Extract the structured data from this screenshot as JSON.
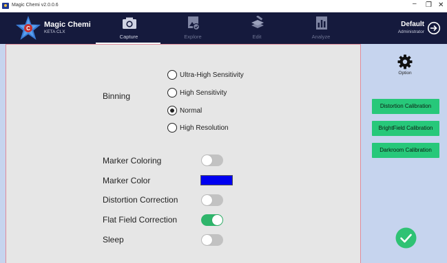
{
  "window": {
    "title": "Magic Chemi v2.0.0.6",
    "controls": [
      "–",
      "❐",
      "✕"
    ]
  },
  "brand": {
    "name": "Magic Chemi",
    "subtitle": "KETA CLX",
    "logo_letter": "C"
  },
  "nav": {
    "active": "Capture",
    "items": [
      {
        "label": "Capture",
        "icon": "camera-icon"
      },
      {
        "label": "Explore",
        "icon": "image-explore-icon"
      },
      {
        "label": "Edit",
        "icon": "edit-layers-icon"
      },
      {
        "label": "Analyze",
        "icon": "analyze-icon"
      }
    ]
  },
  "user": {
    "name": "Default",
    "role": "Administrator"
  },
  "binning": {
    "label": "Binning",
    "selected": "Normal",
    "options": [
      "Ultra-High Sensitivity",
      "High Sensitivity",
      "Normal",
      "High Resolution"
    ]
  },
  "settings": {
    "marker_coloring": {
      "label": "Marker Coloring",
      "on": false
    },
    "marker_color": {
      "label": "Marker Color",
      "color": "#0000f0"
    },
    "distortion_correction": {
      "label": "Distortion Correction",
      "on": false
    },
    "flat_field_correction": {
      "label": "Flat Field Correction",
      "on": true
    },
    "sleep": {
      "label": "Sleep",
      "on": false
    }
  },
  "side": {
    "option_label": "Option",
    "buttons": [
      "Distortion Calibration",
      "BrightField Calibration",
      "Darkroom Calibration"
    ]
  },
  "colors": {
    "header_bg": "#151a3d",
    "accent_green": "#27c87a",
    "toggle_on": "#2fb56b",
    "side_bg": "#c6d4ee"
  }
}
